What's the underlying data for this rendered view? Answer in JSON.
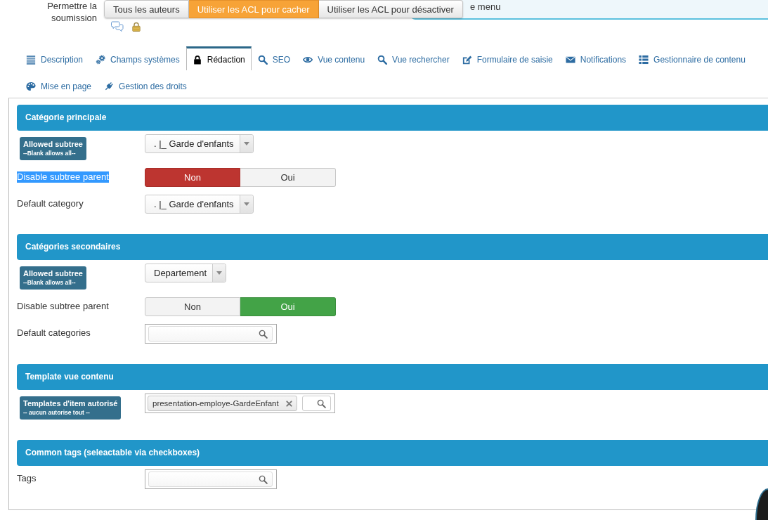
{
  "submission": {
    "label": "Permettre la soumission",
    "options": [
      {
        "label": "Tous les auteurs",
        "selected": false
      },
      {
        "label": "Utiliser les ACL pour cacher",
        "selected": true
      },
      {
        "label": "Utiliser les ACL pour désactiver",
        "selected": false
      }
    ]
  },
  "notice": {
    "text": "e menu"
  },
  "tabs": [
    {
      "label": "Description",
      "selected": false
    },
    {
      "label": "Champs systèmes",
      "selected": false
    },
    {
      "label": "Rédaction",
      "selected": true
    },
    {
      "label": "SEO",
      "selected": false
    },
    {
      "label": "Vue contenu",
      "selected": false
    },
    {
      "label": "Vue rechercher",
      "selected": false
    },
    {
      "label": "Formulaire de saisie",
      "selected": false
    },
    {
      "label": "Notifications",
      "selected": false
    },
    {
      "label": "Gestionnaire de contenu",
      "selected": false
    },
    {
      "label": "Mise en page",
      "selected": false
    },
    {
      "label": "Gestion des droits",
      "selected": false
    }
  ],
  "sections": [
    {
      "title": "Catégorie principale",
      "fields": [
        {
          "kind": "select",
          "label": "Allowed subtree",
          "note": "--Blank allows all--",
          "badge": true,
          "highlighted": false,
          "value": ". |_ Garde d'enfants"
        },
        {
          "kind": "toggle",
          "label": "Disable subtree parent",
          "badge": false,
          "highlighted": true,
          "options": [
            {
              "label": "Non",
              "selected": true
            },
            {
              "label": "Oui",
              "selected": false
            }
          ]
        },
        {
          "kind": "select",
          "label": "Default category",
          "badge": false,
          "highlighted": false,
          "value": ". |_ Garde d'enfants"
        }
      ]
    },
    {
      "title": "Catégories secondaires",
      "fields": [
        {
          "kind": "select",
          "label": "Allowed subtree",
          "note": "--Blank allows all--",
          "badge": true,
          "highlighted": false,
          "value": "Departement"
        },
        {
          "kind": "toggle",
          "label": "Disable subtree parent",
          "badge": false,
          "highlighted": false,
          "options": [
            {
              "label": "Non",
              "selected": false
            },
            {
              "label": "Oui",
              "selected": true
            }
          ]
        },
        {
          "kind": "search",
          "label": "Default categories",
          "badge": false,
          "highlighted": false
        }
      ]
    },
    {
      "title": "Template vue contenu",
      "fields": [
        {
          "kind": "tags",
          "label": "Templates d'item autorisé",
          "note": "-- aucun autorise tout --",
          "badge": true,
          "highlighted": false,
          "chips": [
            "presentation-employe-GardeEnfant"
          ]
        }
      ]
    },
    {
      "title": "Common tags (seleactable via checkboxes)",
      "fields": [
        {
          "kind": "search",
          "label": "Tags",
          "badge": false,
          "highlighted": false
        }
      ]
    }
  ]
}
